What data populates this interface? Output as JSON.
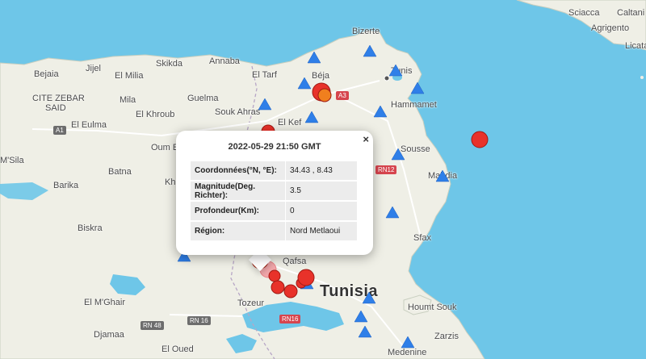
{
  "popup": {
    "title": "2022-05-29 21:50 GMT",
    "close_symbol": "×",
    "rows": [
      {
        "label": "Coordonnées(°N, °E):",
        "value": "34.43 , 8.43"
      },
      {
        "label": "Magnitude(Deg. Richter):",
        "value": "3.5"
      },
      {
        "label": "Profondeur(Km):",
        "value": "0"
      },
      {
        "label": "Région:",
        "value": "Nord Metlaoui"
      }
    ]
  },
  "map": {
    "country_label": "Tunisia",
    "places": {
      "bejaia": "Bejaia",
      "jijel": "Jijel",
      "skikda": "Skikda",
      "annaba": "Annaba",
      "el_tarf": "El Tarf",
      "beja": "Béja",
      "bizerte": "Bizerte",
      "tunis": "Tunis",
      "hammamet": "Hammamet",
      "el_milia": "El Milia",
      "mila": "Mila",
      "guelma": "Guelma",
      "souk_ahras": "Souk Ahras",
      "el_kef": "El Kef",
      "cite_zebar": "CITE ZEBAR",
      "said": "SAID",
      "el_eulma": "El Eulma",
      "el_khroub": "El Khroub",
      "oum_el": "Oum El",
      "msila": "M'Sila",
      "batna": "Batna",
      "barika": "Barika",
      "kh": "Kh",
      "sousse": "Sousse",
      "mahdia": "Mahdia",
      "sfax": "Sfax",
      "biskra": "Biskra",
      "qafsa": "Qafsa",
      "tozeur": "Tozeur",
      "el_mghair": "El M'Ghair",
      "djamaa": "Djamaa",
      "el_oued": "El Oued",
      "houmt_souk": "Houmt Souk",
      "zarzis": "Zarzis",
      "medenine": "Medenine",
      "sciacca": "Sciacca",
      "caltani": "Caltani",
      "agrigento": "Agrigento",
      "licata": "Licata"
    },
    "roads": {
      "a3": "A3",
      "a1": "A1",
      "rn12": "RN12",
      "rn48": "RN 48",
      "rn16a": "RN 16",
      "rn16b": "RN16"
    },
    "colors": {
      "sea": "#6ec6e8",
      "land": "#efefe6",
      "station": "#2f7fe8",
      "quake_red": "#e8322a",
      "quake_orange": "#f07f1e"
    },
    "stations_count": 18,
    "earthquakes_count": 14
  }
}
